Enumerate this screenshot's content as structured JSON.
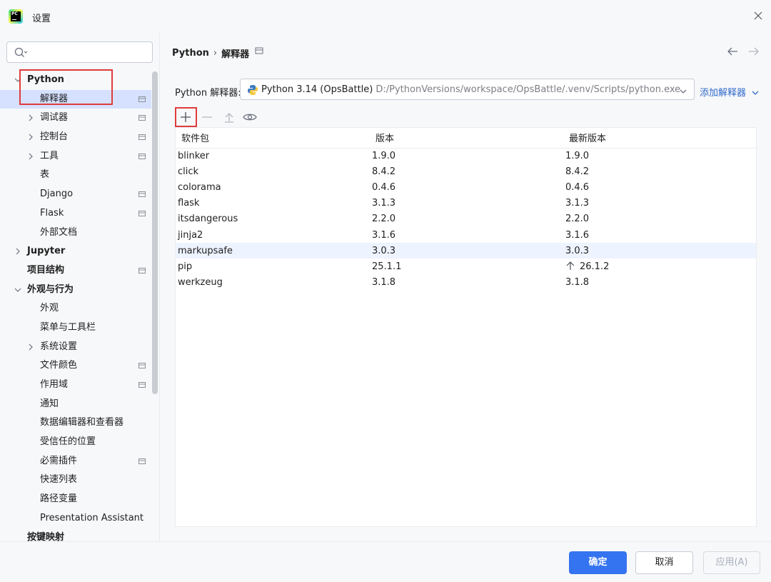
{
  "window": {
    "title": "设置"
  },
  "search": {
    "placeholder": ""
  },
  "sidebar": {
    "items": [
      {
        "label": "Python",
        "bold": true,
        "expanded": true
      },
      {
        "label": "解释器",
        "selected": true
      },
      {
        "label": "调试器"
      },
      {
        "label": "控制台"
      },
      {
        "label": "工具"
      },
      {
        "label": "表"
      },
      {
        "label": "Django"
      },
      {
        "label": "Flask"
      },
      {
        "label": "外部文档"
      },
      {
        "label": "Jupyter",
        "bold": true
      },
      {
        "label": "项目结构",
        "bold": true
      },
      {
        "label": "外观与行为",
        "bold": true,
        "expanded": true
      },
      {
        "label": "外观"
      },
      {
        "label": "菜单与工具栏"
      },
      {
        "label": "系统设置"
      },
      {
        "label": "文件颜色"
      },
      {
        "label": "作用域"
      },
      {
        "label": "通知"
      },
      {
        "label": "数据编辑器和查看器"
      },
      {
        "label": "受信任的位置"
      },
      {
        "label": "必需插件"
      },
      {
        "label": "快速列表"
      },
      {
        "label": "路径变量"
      },
      {
        "label": "Presentation Assistant"
      },
      {
        "label": "按键映射",
        "bold": true
      }
    ],
    "help_label": "?"
  },
  "breadcrumb": {
    "root": "Python",
    "separator": "›",
    "current": "解释器"
  },
  "interpreter": {
    "label": "Python 解释器:",
    "name": "Python 3.14 (OpsBattle)",
    "path": "D:/PythonVersions/workspace/OpsBattle/.venv/Scripts/python.exe",
    "add_label": "添加解释器"
  },
  "packages": {
    "columns": [
      "软件包",
      "版本",
      "最新版本"
    ],
    "rows": [
      {
        "name": "blinker",
        "version": "1.9.0",
        "latest": "1.9.0"
      },
      {
        "name": "click",
        "version": "8.4.2",
        "latest": "8.4.2"
      },
      {
        "name": "colorama",
        "version": "0.4.6",
        "latest": "0.4.6"
      },
      {
        "name": "flask",
        "version": "3.1.3",
        "latest": "3.1.3"
      },
      {
        "name": "itsdangerous",
        "version": "2.2.0",
        "latest": "2.2.0"
      },
      {
        "name": "jinja2",
        "version": "3.1.6",
        "latest": "3.1.6"
      },
      {
        "name": "markupsafe",
        "version": "3.0.3",
        "latest": "3.0.3",
        "selected": true
      },
      {
        "name": "pip",
        "version": "25.1.1",
        "latest": "26.1.2",
        "upgrade": true
      },
      {
        "name": "werkzeug",
        "version": "3.1.8",
        "latest": "3.1.8"
      }
    ]
  },
  "buttons": {
    "ok": "确定",
    "cancel": "取消",
    "apply": "应用(A)"
  },
  "colors": {
    "accent": "#3574f0",
    "highlight": "#e03c3c",
    "selection": "#d5e1ff"
  }
}
